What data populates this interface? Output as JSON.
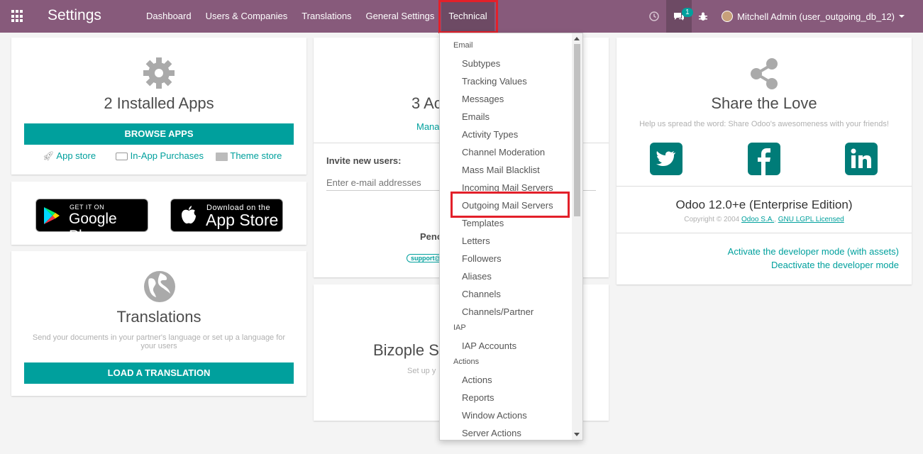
{
  "navbar": {
    "brand": "Settings",
    "menu": [
      "Dashboard",
      "Users & Companies",
      "Translations",
      "General Settings",
      "Technical"
    ],
    "message_count": "1",
    "user": "Mitchell Admin (user_outgoing_db_12)"
  },
  "apps_card": {
    "title": "2 Installed Apps",
    "button": "BROWSE APPS",
    "links": [
      "App store",
      "In-App Purchases",
      "Theme store"
    ]
  },
  "stores": {
    "google_small": "GET IT ON",
    "google_big": "Google Play",
    "apple_small": "Download on the",
    "apple_big": "App Store"
  },
  "translations_card": {
    "title": "Translations",
    "description": "Send your documents in your partner's language or set up a language for your users",
    "button": "LOAD A TRANSLATION"
  },
  "users_card": {
    "title_partial": "3 Ac",
    "manage_partial": "Mana",
    "invite_label": "Invite new users:",
    "email_placeholder": "Enter e-mail addresses",
    "pending_partial": "Penc",
    "support_partial": "support@"
  },
  "bizople_card": {
    "title_partial": "Bizople Se",
    "sub_partial": "Set up y"
  },
  "share_card": {
    "title": "Share the Love",
    "subtitle": "Help us spread the word: Share Odoo's awesomeness with your friends!",
    "version": "Odoo 12.0+e (Enterprise Edition)",
    "copyright_prefix": "Copyright © 2004",
    "company_link": "Odoo S.A.",
    "license_link": "GNU LGPL Licensed",
    "dev_mode_assets": "Activate the developer mode (with assets)",
    "dev_mode_off": "Deactivate the developer mode"
  },
  "dropdown": {
    "email_header": "Email",
    "email_items": [
      "Subtypes",
      "Tracking Values",
      "Messages",
      "Emails",
      "Activity Types",
      "Channel Moderation",
      "Mass Mail Blacklist",
      "Incoming Mail Servers",
      "Outgoing Mail Servers",
      "Templates",
      "Letters",
      "Followers",
      "Aliases",
      "Channels",
      "Channels/Partner"
    ],
    "iap_header": "IAP",
    "iap_items": [
      "IAP Accounts"
    ],
    "actions_header": "Actions",
    "actions_items": [
      "Actions",
      "Reports",
      "Window Actions",
      "Server Actions"
    ]
  },
  "colors": {
    "navbar": "#875a7b",
    "accent": "#00a09d",
    "highlight": "#e3202a"
  }
}
